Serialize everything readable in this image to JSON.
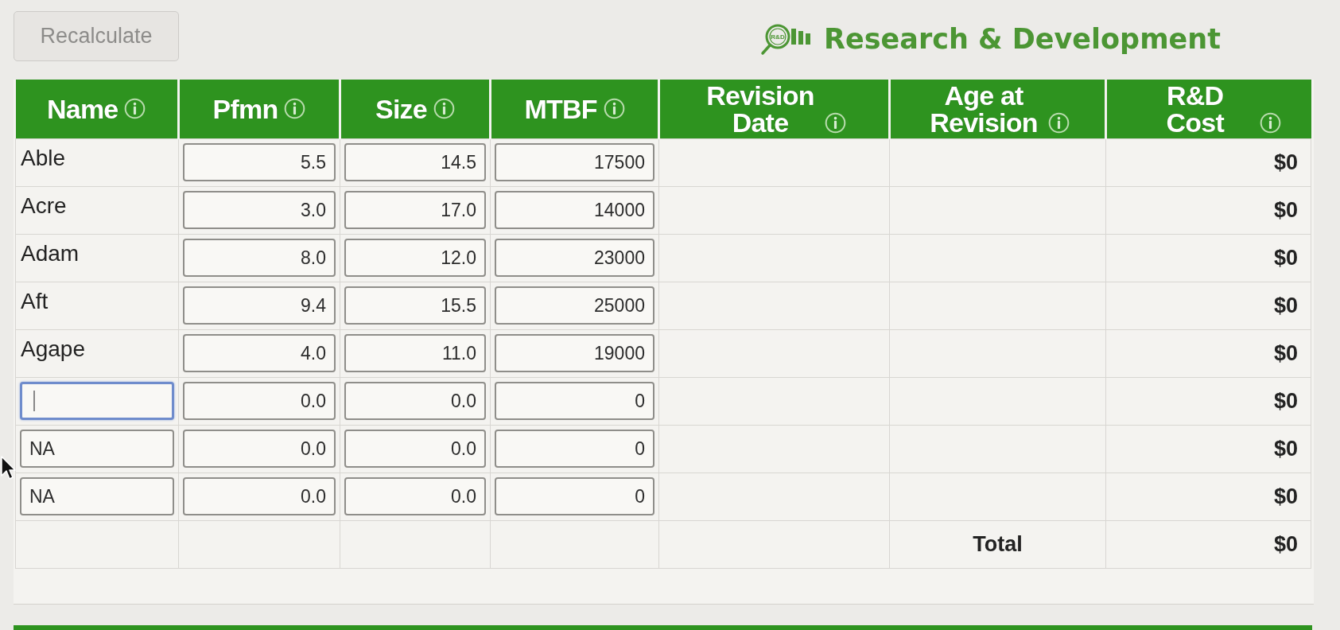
{
  "toolbar": {
    "recalculate": {
      "label": "Recalculate",
      "disabled": true
    }
  },
  "header": {
    "logo_text": "R&D",
    "title": "Research & Development"
  },
  "table": {
    "columns": [
      {
        "label": "Name",
        "info": true
      },
      {
        "label": "Pfmn",
        "info": true
      },
      {
        "label": "Size",
        "info": true
      },
      {
        "label": "MTBF",
        "info": true
      },
      {
        "label": "Revision Date",
        "info": true
      },
      {
        "label": "Age at Revision",
        "info": true
      },
      {
        "label": "R&D Cost",
        "info": true
      }
    ],
    "rows": [
      {
        "name": {
          "kind": "text",
          "value": "Able"
        },
        "pfmn": "5.5",
        "size": "14.5",
        "mtbf": "17500",
        "cost": "$0"
      },
      {
        "name": {
          "kind": "text",
          "value": "Acre"
        },
        "pfmn": "3.0",
        "size": "17.0",
        "mtbf": "14000",
        "cost": "$0"
      },
      {
        "name": {
          "kind": "text",
          "value": "Adam"
        },
        "pfmn": "8.0",
        "size": "12.0",
        "mtbf": "23000",
        "cost": "$0"
      },
      {
        "name": {
          "kind": "text",
          "value": "Aft"
        },
        "pfmn": "9.4",
        "size": "15.5",
        "mtbf": "25000",
        "cost": "$0"
      },
      {
        "name": {
          "kind": "text",
          "value": "Agape"
        },
        "pfmn": "4.0",
        "size": "11.0",
        "mtbf": "19000",
        "cost": "$0"
      },
      {
        "name": {
          "kind": "input",
          "focused": true
        },
        "pfmn": "0.0",
        "size": "0.0",
        "mtbf": "0",
        "cost": "$0"
      },
      {
        "name": {
          "kind": "input",
          "focused": false,
          "value": "NA"
        },
        "pfmn": "0.0",
        "size": "0.0",
        "mtbf": "0",
        "cost": "$0"
      },
      {
        "name": {
          "kind": "input",
          "focused": false,
          "value": "NA"
        },
        "pfmn": "0.0",
        "size": "0.0",
        "mtbf": "0",
        "cost": "$0"
      }
    ],
    "total": {
      "label": "Total",
      "cost": "$0"
    }
  }
}
